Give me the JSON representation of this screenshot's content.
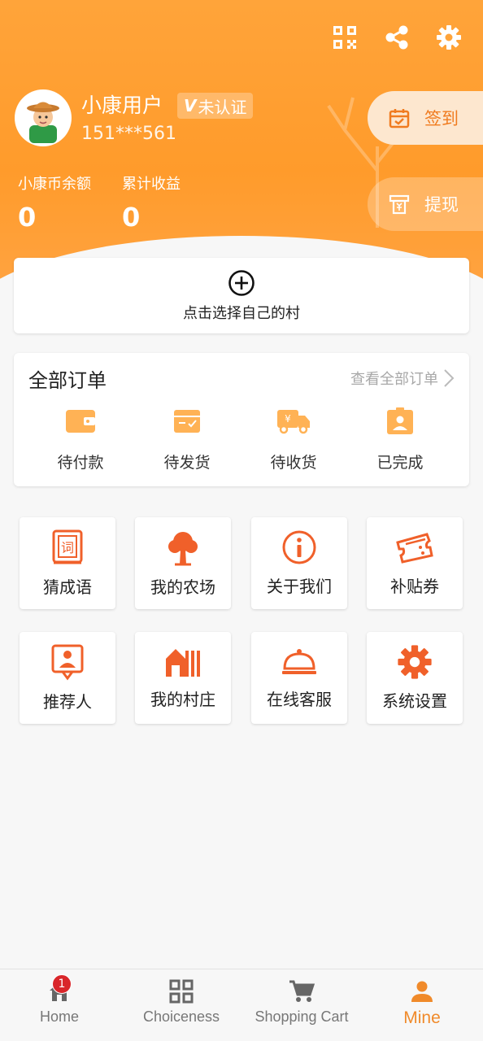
{
  "profile": {
    "username": "小康用户",
    "badge_mark": "V",
    "badge_text": "未认证",
    "phone": "151***561"
  },
  "stats": [
    {
      "label": "小康币余额",
      "value": "0"
    },
    {
      "label": "累计收益",
      "value": "0"
    }
  ],
  "actions": {
    "checkin": "签到",
    "withdraw": "提现"
  },
  "village": {
    "label": "点击选择自己的村"
  },
  "orders": {
    "title": "全部订单",
    "view_all": "查看全部订单",
    "items": [
      {
        "label": "待付款",
        "icon": "wallet-icon"
      },
      {
        "label": "待发货",
        "icon": "package-icon"
      },
      {
        "label": "待收货",
        "icon": "delivery-truck-icon"
      },
      {
        "label": "已完成",
        "icon": "completed-badge-icon"
      }
    ]
  },
  "grid": [
    {
      "label": "猜成语",
      "icon": "idiom-book-icon"
    },
    {
      "label": "我的农场",
      "icon": "tree-icon"
    },
    {
      "label": "关于我们",
      "icon": "info-icon"
    },
    {
      "label": "补贴券",
      "icon": "ticket-icon"
    },
    {
      "label": "推荐人",
      "icon": "referrer-icon"
    },
    {
      "label": "我的村庄",
      "icon": "village-icon"
    },
    {
      "label": "在线客服",
      "icon": "service-bell-icon"
    },
    {
      "label": "系统设置",
      "icon": "gear-icon"
    }
  ],
  "tabs": [
    {
      "label": "Home",
      "icon": "home-icon",
      "badge": "1"
    },
    {
      "label": "Choiceness",
      "icon": "grid-icon"
    },
    {
      "label": "Shopping Cart",
      "icon": "cart-icon"
    },
    {
      "label": "Mine",
      "icon": "person-icon",
      "active": true
    }
  ],
  "colors": {
    "header_orange": "#ff9b2b",
    "accent": "#f0602a",
    "order_icon": "#ffb255",
    "tab_active": "#f08a2a",
    "badge_red": "#d9262a"
  }
}
